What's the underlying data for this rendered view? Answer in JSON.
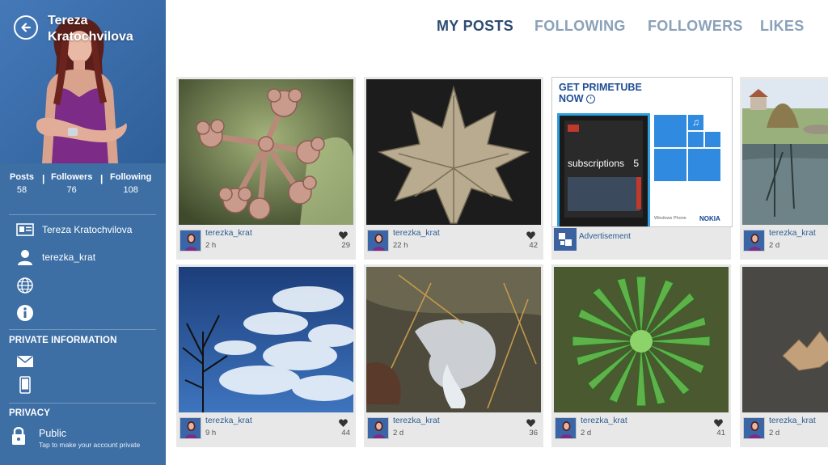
{
  "profile": {
    "name": "Tereza Kratochvilova",
    "full_name": "Tereza Kratochvilova",
    "username": "terezka_krat"
  },
  "stats": [
    {
      "label": "Posts",
      "value": "58"
    },
    {
      "label": "Followers",
      "value": "76"
    },
    {
      "label": "Following",
      "value": "108"
    }
  ],
  "sections": {
    "private_information": "PRIVATE INFORMATION",
    "privacy": "PRIVACY"
  },
  "privacy": {
    "value": "Public",
    "hint": "Tap to make your account private"
  },
  "tabs": [
    {
      "label": "MY POSTS",
      "active": true
    },
    {
      "label": "FOLLOWING",
      "active": false
    },
    {
      "label": "FOLLOWERS",
      "active": false
    },
    {
      "label": "LIKES",
      "active": false
    }
  ],
  "posts": [
    {
      "user": "terezka_krat",
      "time": "2 h",
      "likes": "29",
      "subject": "pink-flower-buds"
    },
    {
      "user": "terezka_krat",
      "time": "22 h",
      "likes": "42",
      "subject": "maple-leaf"
    },
    {
      "user": "",
      "time": "",
      "likes": "",
      "subject": "advertisement"
    },
    {
      "user": "terezka_krat",
      "time": "2 d",
      "likes": "",
      "subject": "pond-village"
    },
    {
      "user": "terezka_krat",
      "time": "9 h",
      "likes": "44",
      "subject": "blue-sky-clouds"
    },
    {
      "user": "terezka_krat",
      "time": "2 d",
      "likes": "36",
      "subject": "ice-and-leaves"
    },
    {
      "user": "terezka_krat",
      "time": "2 d",
      "likes": "41",
      "subject": "green-succulent"
    },
    {
      "user": "terezka_krat",
      "time": "2 d",
      "likes": "",
      "subject": "leaf-on-asphalt"
    }
  ],
  "ad": {
    "headline_line1": "GET PRIMETUBE",
    "headline_line2": "NOW",
    "phone_text": "subscriptions",
    "phone_number": "5",
    "brand": "NOKIA",
    "platform": "Windows Phone",
    "label": "Advertisement"
  },
  "colors": {
    "sidebar": "#3d6fa5",
    "tab_active": "#2d4b72",
    "tab_inactive": "#8ba1b8",
    "link": "#2d5d92",
    "card_bg": "#e8e8e8"
  },
  "icons": {
    "back": "back-arrow-icon",
    "id_card": "id-card-icon",
    "user": "user-icon",
    "globe": "globe-icon",
    "info": "info-icon",
    "mail": "mail-icon",
    "phone": "phone-icon",
    "lock": "lock-icon",
    "heart": "heart-icon"
  }
}
